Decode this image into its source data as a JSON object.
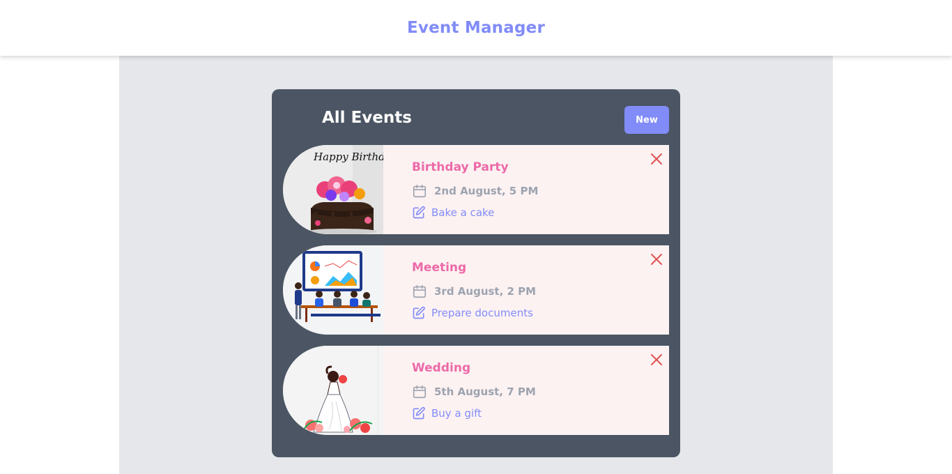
{
  "header": {
    "title": "Event Manager"
  },
  "panel": {
    "title": "All Events",
    "new_button": "New"
  },
  "events": [
    {
      "name": "Birthday Party",
      "date": "2nd August, 5 PM",
      "note": "Bake a cake",
      "image": "birthday-cake-image",
      "image_text": "Happy Birthday"
    },
    {
      "name": "Meeting",
      "date": "3rd August, 2 PM",
      "note": "Prepare documents",
      "image": "meeting-illustration"
    },
    {
      "name": "Wedding",
      "date": "5th August, 7 PM",
      "note": "Buy a gift",
      "image": "wedding-illustration"
    }
  ],
  "icons": {
    "date": "calendar-icon",
    "note": "edit-icon",
    "delete": "close-icon"
  },
  "colors": {
    "accent": "#818cf8",
    "event_name": "#ec6aa8",
    "delete": "#e05252",
    "panel": "#4b5563",
    "card": "#fdf2f2",
    "page": "#e5e7eb"
  }
}
